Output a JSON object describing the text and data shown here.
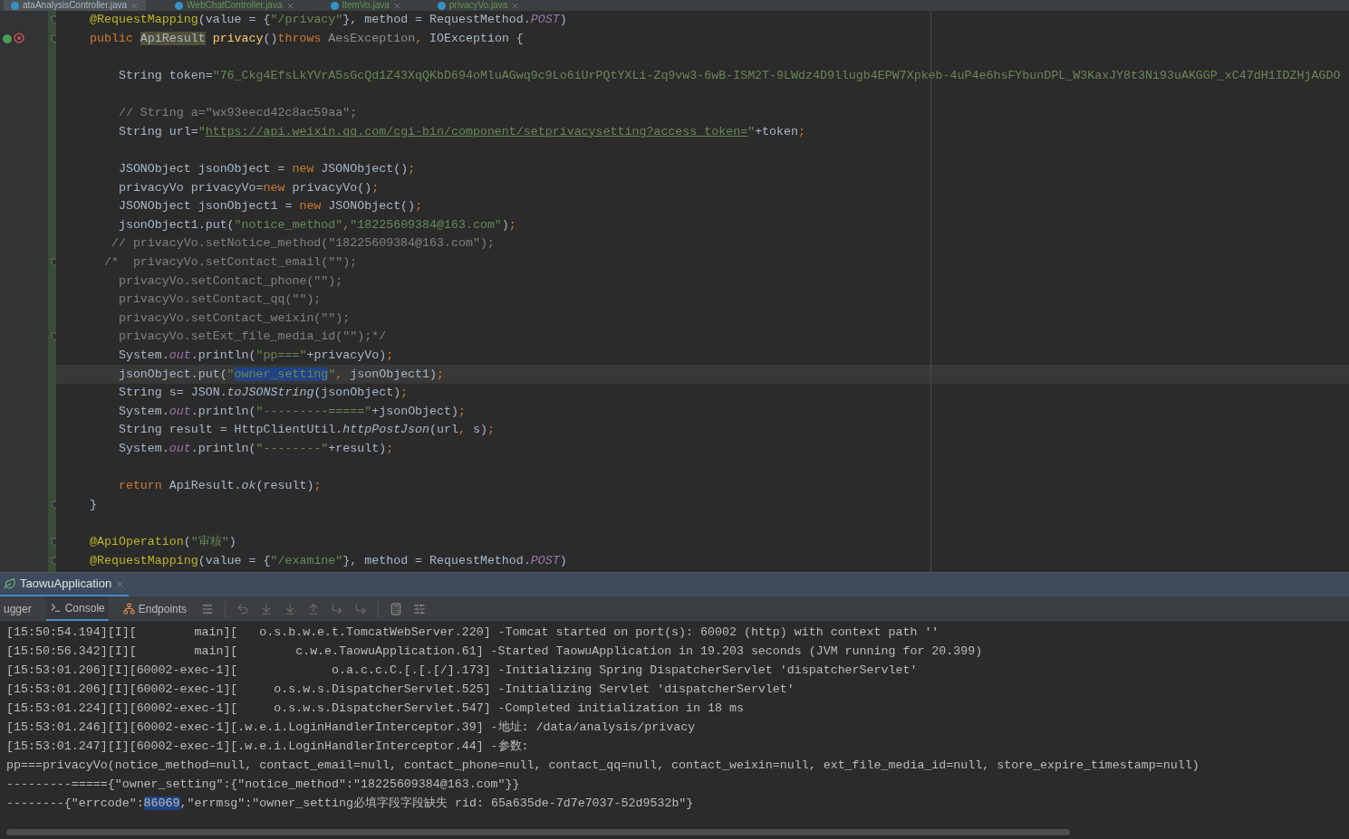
{
  "editor_tabs": [
    {
      "label": "ataAnalysisController.java",
      "selected": true
    },
    {
      "label": "WebChatController.java",
      "selected": false
    },
    {
      "label": "ItemVo.java",
      "selected": false
    },
    {
      "label": "privacyVo.java",
      "selected": false
    }
  ],
  "code_lines": [
    {
      "fold": true,
      "current": false,
      "gutter_icons": false,
      "segments": [
        {
          "t": "@RequestMapping",
          "kind": "annotation"
        },
        {
          "t": "(value = {",
          "kind": "plain"
        },
        {
          "t": "\"/privacy\"",
          "kind": "string"
        },
        {
          "t": "}, method = RequestMethod.",
          "kind": "plain"
        },
        {
          "t": "POST",
          "kind": "field"
        },
        {
          "t": ")",
          "kind": "plain"
        }
      ]
    },
    {
      "fold": true,
      "current": false,
      "gutter_icons": true,
      "segments": [
        {
          "t": "public ",
          "kind": "keyword"
        },
        {
          "t": "ApiResult",
          "kind": "highlight"
        },
        {
          "t": " privacy",
          "kind": "method"
        },
        {
          "t": "()",
          "kind": "plain"
        },
        {
          "t": "throws ",
          "kind": "keyword"
        },
        {
          "t": "AesException",
          "kind": "unused"
        },
        {
          "t": ", ",
          "kind": "keyword"
        },
        {
          "t": "IOException {",
          "kind": "plain"
        }
      ]
    },
    {
      "fold": false,
      "current": false,
      "gutter_icons": false
    },
    {
      "fold": false,
      "current": false,
      "gutter_icons": false,
      "segments": [
        {
          "t": "    String token=",
          "kind": "plain"
        },
        {
          "t": "\"76_Ckg4EfsLkYVrA5sGcQd1Z43XqQKbD694oMluAGwq9c9Lo6iUrPQtYXLi-Zq9vw3-6wB-ISM2T-9LWdz4D9llugb4EPW7Xpkeb-4uP4e6hsFYbunDPL_W3KaxJY8t3Ni93uAKGGP_xC47dH1IDZHjAGDO",
          "kind": "string"
        }
      ]
    },
    {
      "fold": false,
      "current": false,
      "gutter_icons": false
    },
    {
      "fold": false,
      "current": false,
      "gutter_icons": false,
      "segments": [
        {
          "t": "    // String a=\"wx93eecd42c8ac59aa\";",
          "kind": "comment"
        }
      ]
    },
    {
      "fold": false,
      "current": false,
      "gutter_icons": false,
      "segments": [
        {
          "t": "    String url=",
          "kind": "plain"
        },
        {
          "t": "\"",
          "kind": "string"
        },
        {
          "t": "https://api.weixin.qq.com/cgi-bin/component/setprivacysetting?access_token=",
          "kind": "link"
        },
        {
          "t": "\"",
          "kind": "string"
        },
        {
          "t": "+token",
          "kind": "plain"
        },
        {
          "t": ";",
          "kind": "keyword"
        }
      ]
    },
    {
      "fold": false,
      "current": false,
      "gutter_icons": false
    },
    {
      "fold": false,
      "current": false,
      "gutter_icons": false,
      "segments": [
        {
          "t": "    JSONObject jsonObject = ",
          "kind": "plain"
        },
        {
          "t": "new ",
          "kind": "keyword"
        },
        {
          "t": "JSONObject()",
          "kind": "plain"
        },
        {
          "t": ";",
          "kind": "keyword"
        }
      ]
    },
    {
      "fold": false,
      "current": false,
      "gutter_icons": false,
      "segments": [
        {
          "t": "    privacyVo privacyVo=",
          "kind": "plain"
        },
        {
          "t": "new ",
          "kind": "keyword"
        },
        {
          "t": "privacyVo()",
          "kind": "plain"
        },
        {
          "t": ";",
          "kind": "keyword"
        }
      ]
    },
    {
      "fold": false,
      "current": false,
      "gutter_icons": false,
      "segments": [
        {
          "t": "    JSONObject jsonObject1 = ",
          "kind": "plain"
        },
        {
          "t": "new ",
          "kind": "keyword"
        },
        {
          "t": "JSONObject()",
          "kind": "plain"
        },
        {
          "t": ";",
          "kind": "keyword"
        }
      ]
    },
    {
      "fold": false,
      "current": false,
      "gutter_icons": false,
      "segments": [
        {
          "t": "    jsonObject1.put(",
          "kind": "plain"
        },
        {
          "t": "\"notice_method\"",
          "kind": "string"
        },
        {
          "t": ",",
          "kind": "keyword"
        },
        {
          "t": "\"18225609384@163.com\"",
          "kind": "string"
        },
        {
          "t": ")",
          "kind": "plain"
        },
        {
          "t": ";",
          "kind": "keyword"
        }
      ]
    },
    {
      "fold": false,
      "current": false,
      "gutter_icons": false,
      "segments": [
        {
          "t": "   // privacyVo.setNotice_method(\"18225609384@163.com\");",
          "kind": "comment"
        }
      ]
    },
    {
      "fold": true,
      "current": false,
      "gutter_icons": false,
      "segments": [
        {
          "t": "  /*  privacyVo.setContact_email(\"\");",
          "kind": "comment"
        }
      ]
    },
    {
      "fold": false,
      "current": false,
      "gutter_icons": false,
      "segments": [
        {
          "t": "    privacyVo.setContact_phone(\"\");",
          "kind": "comment"
        }
      ]
    },
    {
      "fold": false,
      "current": false,
      "gutter_icons": false,
      "segments": [
        {
          "t": "    privacyVo.setContact_qq(\"\");",
          "kind": "comment"
        }
      ]
    },
    {
      "fold": false,
      "current": false,
      "gutter_icons": false,
      "segments": [
        {
          "t": "    privacyVo.setContact_weixin(\"\");",
          "kind": "comment"
        }
      ]
    },
    {
      "fold": true,
      "current": false,
      "gutter_icons": false,
      "segments": [
        {
          "t": "    privacyVo.setExt_file_media_id(\"\");*/",
          "kind": "comment"
        }
      ]
    },
    {
      "fold": false,
      "current": false,
      "gutter_icons": false,
      "segments": [
        {
          "t": "    System.",
          "kind": "plain"
        },
        {
          "t": "out",
          "kind": "field"
        },
        {
          "t": ".println(",
          "kind": "plain"
        },
        {
          "t": "\"pp===\"",
          "kind": "string"
        },
        {
          "t": "+privacyVo)",
          "kind": "plain"
        },
        {
          "t": ";",
          "kind": "keyword"
        }
      ]
    },
    {
      "fold": false,
      "current": true,
      "gutter_icons": false,
      "segments": [
        {
          "t": "    jsonObject.put(",
          "kind": "plain"
        },
        {
          "t": "\"",
          "kind": "string"
        },
        {
          "t": "owner_setting",
          "kind": "selection"
        },
        {
          "t": "\"",
          "kind": "string"
        },
        {
          "t": ", ",
          "kind": "keyword"
        },
        {
          "t": "jsonObject1)",
          "kind": "plain"
        },
        {
          "t": ";",
          "kind": "keyword"
        }
      ]
    },
    {
      "fold": false,
      "current": false,
      "gutter_icons": false,
      "segments": [
        {
          "t": "    String s= JSON.",
          "kind": "plain"
        },
        {
          "t": "toJSONString",
          "kind": "italic"
        },
        {
          "t": "(jsonObject)",
          "kind": "plain"
        },
        {
          "t": ";",
          "kind": "keyword"
        }
      ]
    },
    {
      "fold": false,
      "current": false,
      "gutter_icons": false,
      "segments": [
        {
          "t": "    System.",
          "kind": "plain"
        },
        {
          "t": "out",
          "kind": "field"
        },
        {
          "t": ".println(",
          "kind": "plain"
        },
        {
          "t": "\"---------=====\"",
          "kind": "string"
        },
        {
          "t": "+jsonObject)",
          "kind": "plain"
        },
        {
          "t": ";",
          "kind": "keyword"
        }
      ]
    },
    {
      "fold": false,
      "current": false,
      "gutter_icons": false,
      "segments": [
        {
          "t": "    String result = HttpClientUtil.",
          "kind": "plain"
        },
        {
          "t": "httpPostJson",
          "kind": "italic"
        },
        {
          "t": "(url",
          "kind": "plain"
        },
        {
          "t": ", ",
          "kind": "keyword"
        },
        {
          "t": "s)",
          "kind": "plain"
        },
        {
          "t": ";",
          "kind": "keyword"
        }
      ]
    },
    {
      "fold": false,
      "current": false,
      "gutter_icons": false,
      "segments": [
        {
          "t": "    System.",
          "kind": "plain"
        },
        {
          "t": "out",
          "kind": "field"
        },
        {
          "t": ".println(",
          "kind": "plain"
        },
        {
          "t": "\"--------\"",
          "kind": "string"
        },
        {
          "t": "+result)",
          "kind": "plain"
        },
        {
          "t": ";",
          "kind": "keyword"
        }
      ]
    },
    {
      "fold": false,
      "current": false,
      "gutter_icons": false
    },
    {
      "fold": false,
      "current": false,
      "gutter_icons": false,
      "segments": [
        {
          "t": "    return ",
          "kind": "keyword"
        },
        {
          "t": "ApiResult.",
          "kind": "plain"
        },
        {
          "t": "ok",
          "kind": "italic"
        },
        {
          "t": "(result)",
          "kind": "plain"
        },
        {
          "t": ";",
          "kind": "keyword"
        }
      ]
    },
    {
      "fold": true,
      "current": false,
      "gutter_icons": false,
      "segments": [
        {
          "t": "}",
          "kind": "plain"
        }
      ]
    },
    {
      "fold": false,
      "current": false,
      "gutter_icons": false
    },
    {
      "fold": true,
      "current": false,
      "gutter_icons": false,
      "segments": [
        {
          "t": "@ApiOperation",
          "kind": "annotation"
        },
        {
          "t": "(",
          "kind": "plain"
        },
        {
          "t": "\"审核\"",
          "kind": "string"
        },
        {
          "t": ")",
          "kind": "plain"
        }
      ]
    },
    {
      "fold": true,
      "current": false,
      "gutter_icons": false,
      "segments": [
        {
          "t": "@RequestMapping",
          "kind": "annotation"
        },
        {
          "t": "(value = {",
          "kind": "plain"
        },
        {
          "t": "\"/examine\"",
          "kind": "string"
        },
        {
          "t": "}, method = RequestMethod.",
          "kind": "plain"
        },
        {
          "t": "POST",
          "kind": "field"
        },
        {
          "t": ")",
          "kind": "plain"
        }
      ]
    }
  ],
  "run_tab": {
    "label": "TaowuApplication"
  },
  "console_tabs": [
    {
      "label": "ugger",
      "selected": false,
      "kind": "plain"
    },
    {
      "label": "Console",
      "selected": true,
      "kind": "console"
    },
    {
      "label": "Endpoints",
      "selected": false,
      "kind": "endpoints"
    }
  ],
  "console_lines": [
    {
      "segments": [
        {
          "t": "[15:50:54.194][I][        main][   o.s.b.w.e.t.TomcatWebServer.220] -Tomcat started on port(s): 60002 (http) with context path ''",
          "kind": "plain"
        }
      ]
    },
    {
      "segments": [
        {
          "t": "[15:50:56.342][I][        main][        c.w.e.TaowuApplication.61] -Started TaowuApplication in 19.203 seconds (JVM running for 20.399)",
          "kind": "plain"
        }
      ]
    },
    {
      "segments": [
        {
          "t": "[15:53:01.206][I][60002-exec-1][             o.a.c.c.C.[.[.[/].173] -Initializing Spring DispatcherServlet 'dispatcherServlet'",
          "kind": "plain"
        }
      ]
    },
    {
      "segments": [
        {
          "t": "[15:53:01.206][I][60002-exec-1][     o.s.w.s.DispatcherServlet.525] -Initializing Servlet 'dispatcherServlet'",
          "kind": "plain"
        }
      ]
    },
    {
      "segments": [
        {
          "t": "[15:53:01.224][I][60002-exec-1][     o.s.w.s.DispatcherServlet.547] -Completed initialization in 18 ms",
          "kind": "plain"
        }
      ]
    },
    {
      "segments": [
        {
          "t": "[15:53:01.246][I][60002-exec-1][.w.e.i.LoginHandlerInterceptor.39] -地址: /data/analysis/privacy",
          "kind": "plain"
        }
      ]
    },
    {
      "segments": [
        {
          "t": "[15:53:01.247][I][60002-exec-1][.w.e.i.LoginHandlerInterceptor.44] -参数:",
          "kind": "plain"
        }
      ]
    },
    {
      "segments": [
        {
          "t": "pp===privacyVo(notice_method=null, contact_email=null, contact_phone=null, contact_qq=null, contact_weixin=null, ext_file_media_id=null, store_expire_timestamp=null)",
          "kind": "plain"
        }
      ]
    },
    {
      "segments": [
        {
          "t": "---------====={\"owner_setting\":{\"notice_method\":\"18225609384@163.com\"}}",
          "kind": "plain"
        }
      ]
    },
    {
      "segments": [
        {
          "t": "--------{\"errcode\":",
          "kind": "plain"
        },
        {
          "t": "86069",
          "kind": "selection"
        },
        {
          "t": ",\"errmsg\":\"owner_setting必填字段字段缺失 rid: 65a635de-7d7e7037-52d9532b\"}",
          "kind": "plain"
        }
      ]
    }
  ]
}
